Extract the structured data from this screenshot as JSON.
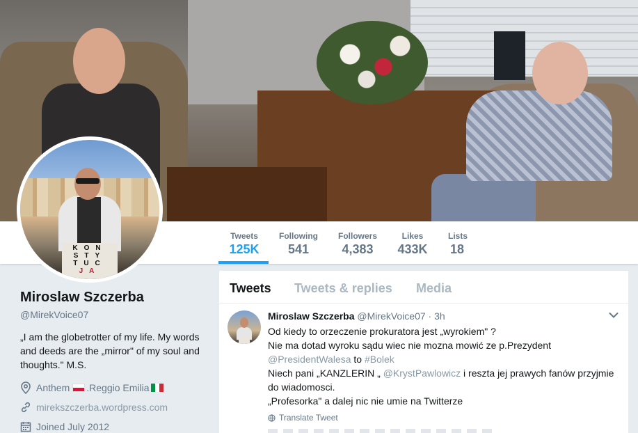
{
  "profile": {
    "name": "Miroslaw Szczerba",
    "handle": "@MirekVoice07",
    "bio": "„I am the globetrotter of my life. My words and deeds are the „mirror\" of my soul and thoughts.\" M.S.",
    "location_prefix": "Anthem",
    "location_city": ".Reggio Emilia",
    "website": "mirekszczerba.wordpress.com",
    "joined": "Joined July 2012",
    "avatar_logo": {
      "line1": "KON",
      "line2": "STY",
      "line3": "TUC",
      "line4": "JA"
    }
  },
  "stats": [
    {
      "label": "Tweets",
      "value": "125K"
    },
    {
      "label": "Following",
      "value": "541"
    },
    {
      "label": "Followers",
      "value": "4,383"
    },
    {
      "label": "Likes",
      "value": "433K"
    },
    {
      "label": "Lists",
      "value": "18"
    }
  ],
  "tabs": [
    "Tweets",
    "Tweets & replies",
    "Media"
  ],
  "tweet": {
    "name": "Miroslaw Szczerba",
    "handle": "@MirekVoice07",
    "dot": "·",
    "time": "3h",
    "line1": "Od kiedy to orzeczenie prokuratora jest „wyrokiem\" ?",
    "line2": "Nie ma dotad wyroku sądu wiec nie mozna mowić ze p.Prezydent",
    "mention1": "@PresidentWalesa",
    "to_word": " to ",
    "hashtag": "#Bolek",
    "line4_start": "Niech pani „KANZLERIN „ ",
    "mention2": "@KrystPawlowicz",
    "line4_end": " i reszta jej prawych fanów przyjmie do wiadomosci.",
    "line5": "„Profesorka\" a dalej nic nie umie na Twitterze",
    "translate": "Translate Tweet"
  },
  "colors": {
    "accent": "#1da1f2",
    "muted": "#657786",
    "background": "#e6ecf0"
  },
  "icons": [
    "location-pin-icon",
    "link-icon",
    "calendar-icon",
    "globe-icon",
    "chevron-down-icon"
  ]
}
